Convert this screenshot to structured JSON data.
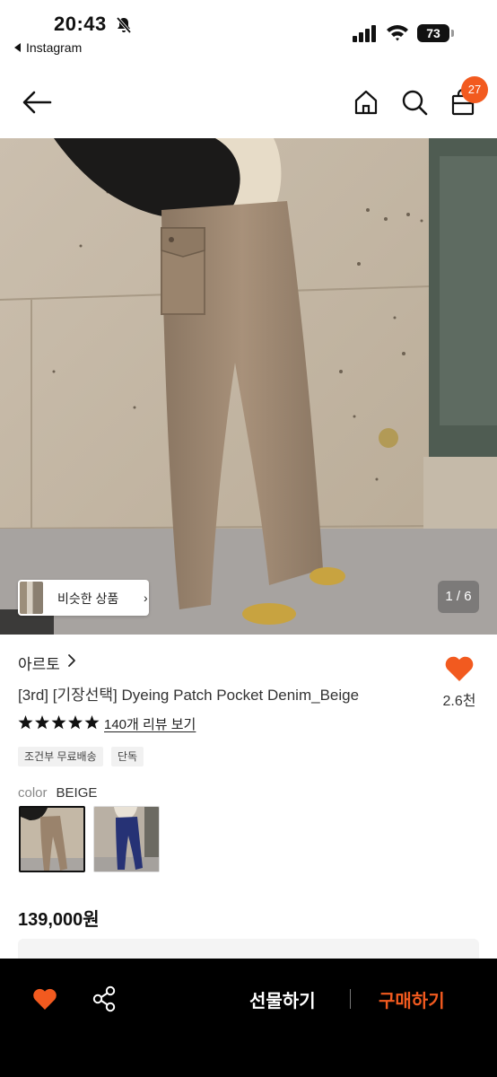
{
  "status_bar": {
    "time": "20:43",
    "back_app": "Instagram",
    "battery": "73",
    "icons": [
      "bell-off-icon",
      "signal-icon",
      "wifi-icon",
      "battery-icon"
    ]
  },
  "header": {
    "icons": [
      "arrow-left-icon",
      "home-icon",
      "search-icon",
      "shopping-bag-icon"
    ],
    "cart_count": "27"
  },
  "gallery": {
    "similar_label": "비슷한 상품",
    "similar_chevron": "›",
    "page_indicator": "1 / 6"
  },
  "product": {
    "brand": "아르토",
    "title": "[3rd] [기장선택] Dyeing Patch Pocket Denim_Beige",
    "wish_count": "2.6천",
    "rating": 5,
    "review_link": "140개 리뷰 보기",
    "tags": [
      "조건부 무료배송",
      "단독"
    ],
    "color_label": "color",
    "color_value": "BEIGE",
    "swatches": [
      {
        "name": "beige",
        "selected": true
      },
      {
        "name": "navy",
        "selected": false
      }
    ],
    "price": "139,000원"
  },
  "bottom_bar": {
    "gift_label": "선물하기",
    "buy_label": "구매하기"
  },
  "colors": {
    "accent": "#f25a1f",
    "bottom_bar_bg": "#000000",
    "badge": "#f25a1f"
  }
}
